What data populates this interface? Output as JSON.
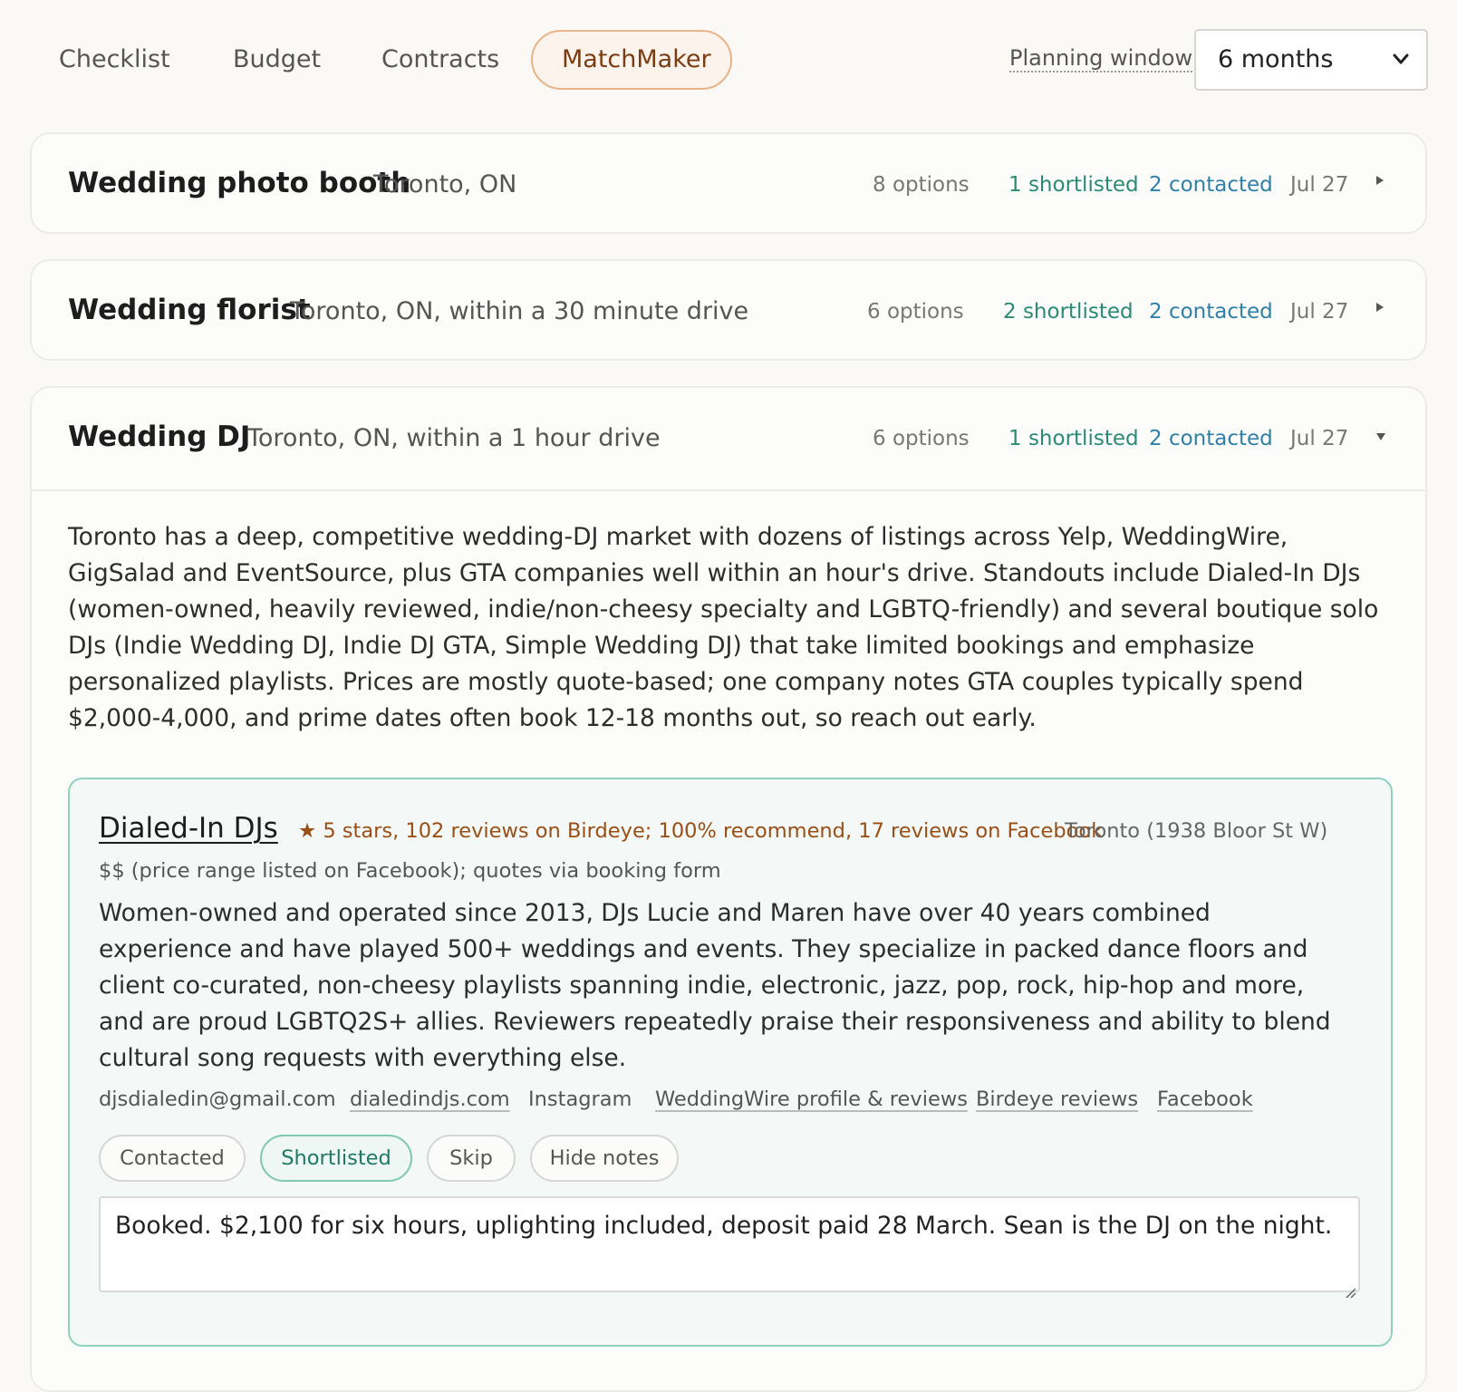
{
  "nav": {
    "tabs": [
      "Checklist",
      "Budget",
      "Contracts",
      "MatchMaker"
    ],
    "active_tab": "MatchMaker",
    "planning_window_label": "Planning window",
    "planning_window_value": "6 months"
  },
  "cards": [
    {
      "title": "Wedding photo booth",
      "location": "Toronto, ON",
      "options": "8 options",
      "shortlisted": "1 shortlisted",
      "contacted": "2 contacted",
      "date": "Jul 27",
      "expanded": false
    },
    {
      "title": "Wedding florist",
      "location": "Toronto, ON, within a 30 minute drive",
      "options": "6 options",
      "shortlisted": "2 shortlisted",
      "contacted": "2 contacted",
      "date": "Jul 27",
      "expanded": false
    },
    {
      "title": "Wedding DJ",
      "location": "Toronto, ON, within a 1 hour drive",
      "options": "6 options",
      "shortlisted": "1 shortlisted",
      "contacted": "2 contacted",
      "date": "Jul 27",
      "expanded": true,
      "summary": "Toronto has a deep, competitive wedding-DJ market with dozens of listings across Yelp, WeddingWire, GigSalad and EventSource, plus GTA companies well within an hour's drive. Standouts include Dialed-In DJs (women-owned, heavily reviewed, indie/non-cheesy specialty and LGBTQ-friendly) and several boutique solo DJs (Indie Wedding DJ, Indie DJ GTA, Simple Wedding DJ) that take limited bookings and emphasize personalized playlists. Prices are mostly quote-based; one company notes GTA couples typically spend $2,000-4,000, and prime dates often book 12-18 months out, so reach out early.",
      "vendor": {
        "name": "Dialed-In DJs",
        "rating": "★ 5 stars, 102 reviews on Birdeye; 100% recommend, 17 reviews on Facebook",
        "address": "Toronto (1938 Bloor St W)",
        "price": "$$ (price range listed on Facebook); quotes via booking form",
        "description": "Women-owned and operated since 2013, DJs Lucie and Maren have over 40 years combined experience and have played 500+ weddings and events. They specialize in packed dance floors and client co-curated, non-cheesy playlists spanning indie, electronic, jazz, pop, rock, hip-hop and more, and are proud LGBTQ2S+ allies. Reviewers repeatedly praise their responsiveness and ability to blend cultural song requests with everything else.",
        "links": {
          "email": "djsdialedin@gmail.com",
          "website": "dialedindjs.com",
          "instagram": "Instagram",
          "weddingwire": "WeddingWire profile & reviews",
          "birdeye": "Birdeye reviews",
          "facebook": "Facebook"
        },
        "actions": {
          "contacted": "Contacted",
          "shortlisted": "Shortlisted",
          "skip": "Skip",
          "hide_notes": "Hide notes"
        },
        "notes": "Booked. $2,100 for six hours, uplighting included, deposit paid 28 March. Sean is the DJ on the night."
      }
    }
  ],
  "colors": {
    "accent_tab_border": "#e7b48a",
    "shortlisted": "#2a8a72",
    "contacted": "#2f7fa6",
    "vendor_border": "#8fd3bf",
    "rating": "#9a4f17"
  }
}
